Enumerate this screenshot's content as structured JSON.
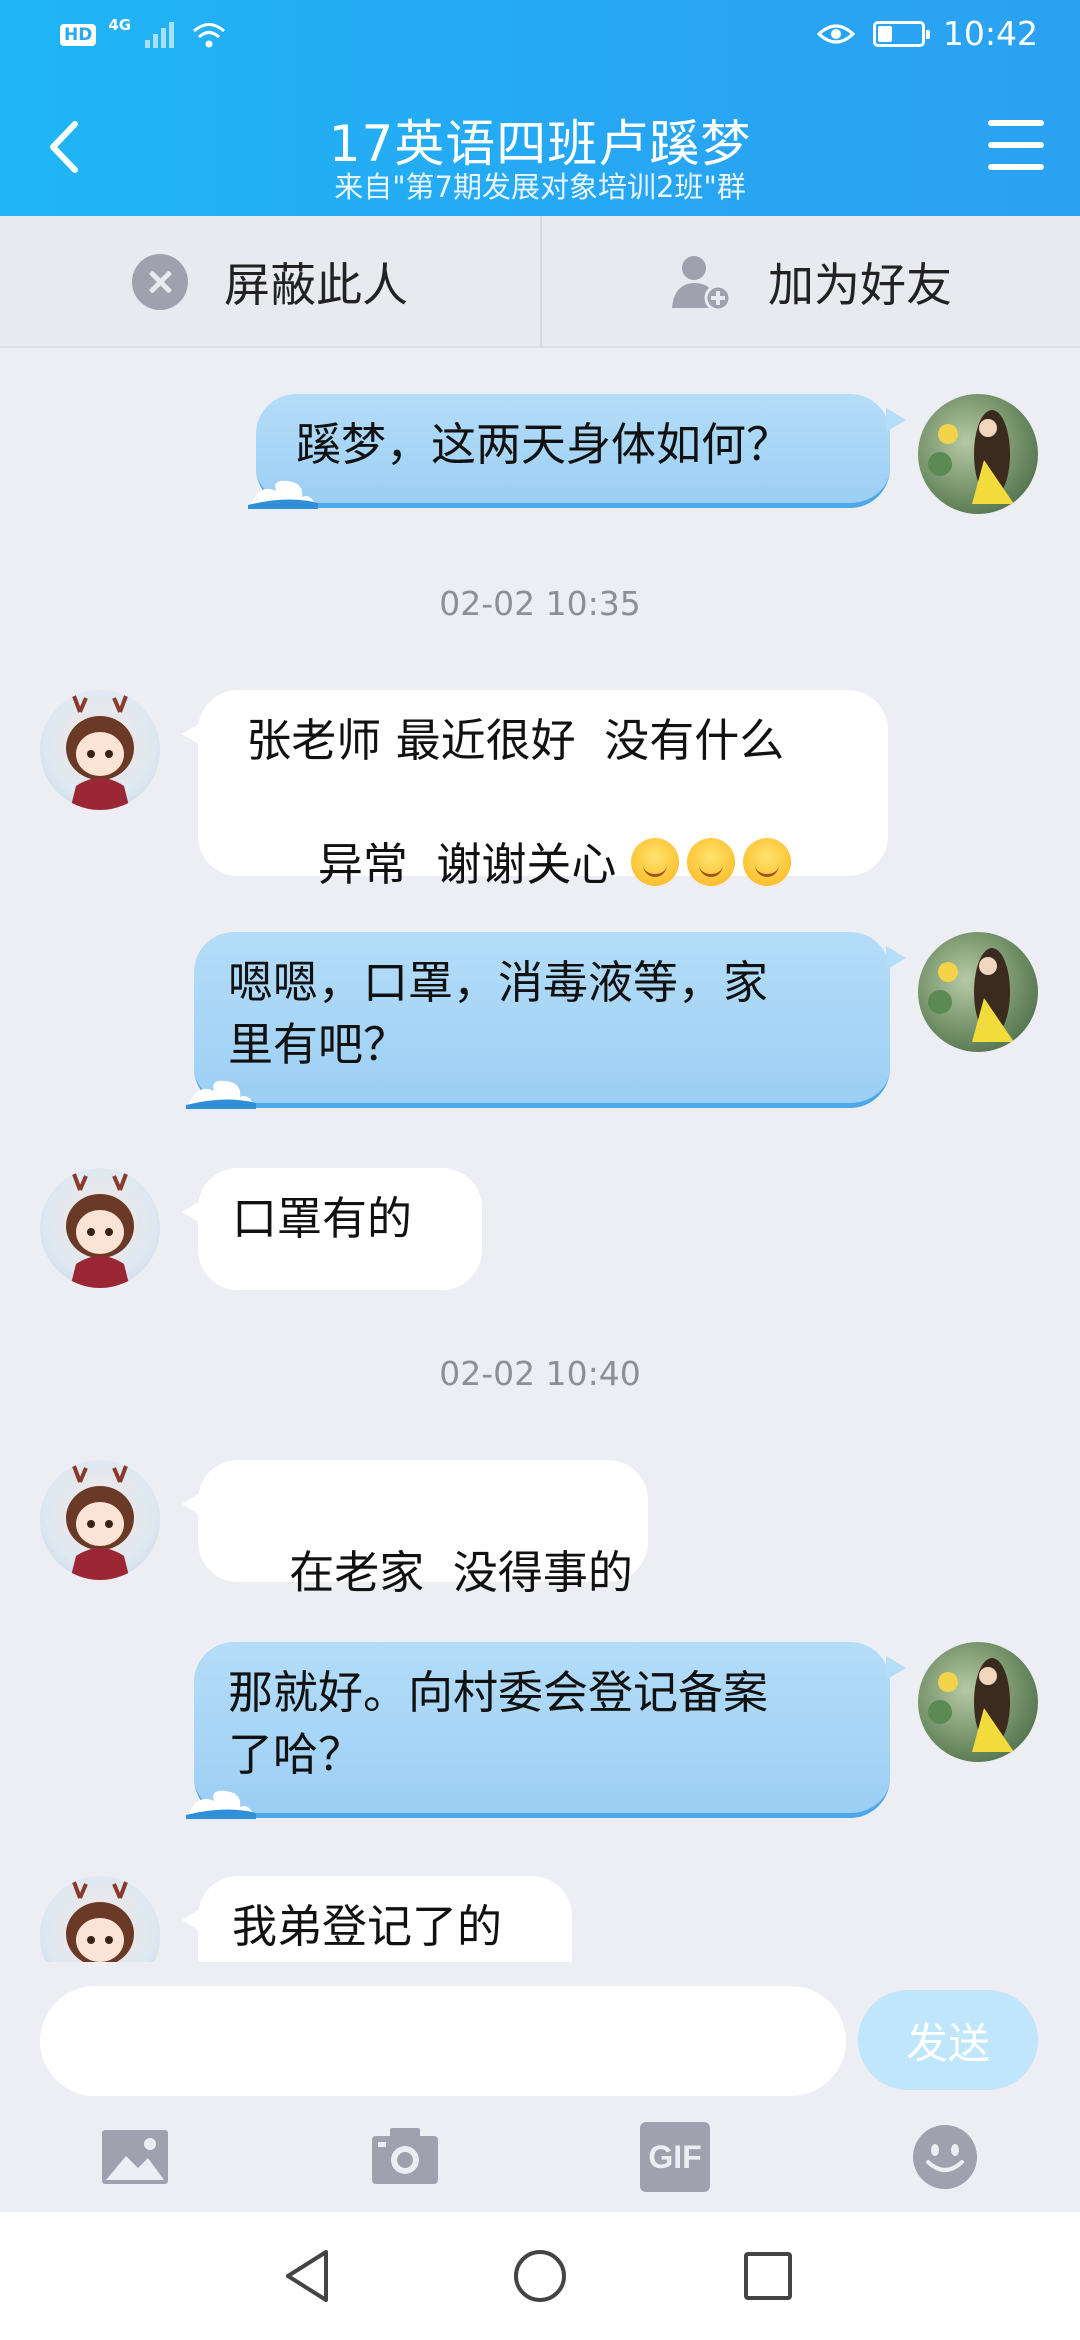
{
  "status_bar": {
    "hd": "HD",
    "network": "4G",
    "time": "10:42"
  },
  "header": {
    "title": "17英语四班卢蹊梦",
    "subtitle": "来自\"第7期发展对象培训2班\"群",
    "back_icon": "chevron-left-icon",
    "menu_icon": "hamburger-icon"
  },
  "actions": {
    "block_label": "屏蔽此人",
    "add_friend_label": "加为好友"
  },
  "messages": [
    {
      "side": "out",
      "text": "蹊梦，这两天身体如何？"
    },
    {
      "type": "time",
      "text": "02-02 10:35"
    },
    {
      "side": "in",
      "line1": " 张老师 最近很好  没有什么",
      "line2": "异常  谢谢关心 ",
      "emoji_count": 3
    },
    {
      "side": "out",
      "line1": "嗯嗯，口罩，消毒液等，家",
      "line2": "里有吧？"
    },
    {
      "side": "in",
      "text": "口罩有的"
    },
    {
      "type": "time",
      "text": "02-02 10:40"
    },
    {
      "side": "in",
      "text": "在老家  没得事的"
    },
    {
      "side": "out",
      "line1": "那就好。向村委会登记备案",
      "line2": "了哈？"
    },
    {
      "side": "in",
      "text": "我弟登记了的"
    }
  ],
  "input": {
    "value": "",
    "placeholder": "",
    "send_label": "发送"
  },
  "toolbar": {
    "items": [
      "image-icon",
      "camera-icon",
      "gif-icon",
      "emoji-icon"
    ],
    "gif_label": "GIF"
  },
  "colors": {
    "header": "#27a6f3",
    "out_bubble": "#a9d6f6",
    "in_bubble": "#ffffff",
    "background": "#eceef4",
    "send_button": "#bfe6fb"
  }
}
